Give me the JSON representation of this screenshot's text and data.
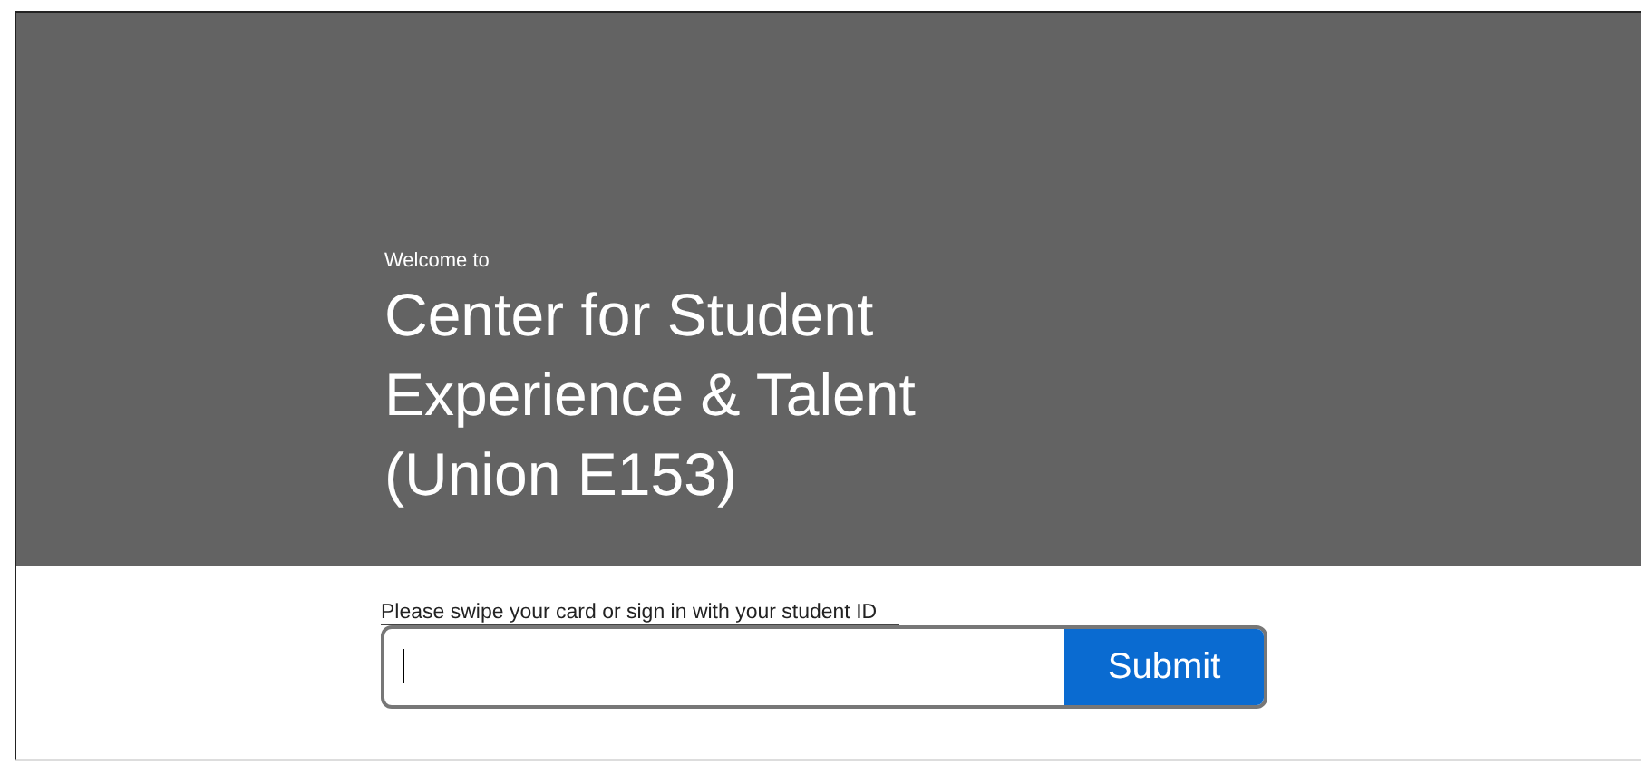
{
  "header": {
    "welcome": "Welcome to",
    "title_lines": [
      "Center for Student",
      "Experience & Talent",
      "(Union E153)"
    ]
  },
  "form": {
    "label": "Please swipe your card or sign in with your student ID",
    "submit": "Submit",
    "focused": true
  }
}
